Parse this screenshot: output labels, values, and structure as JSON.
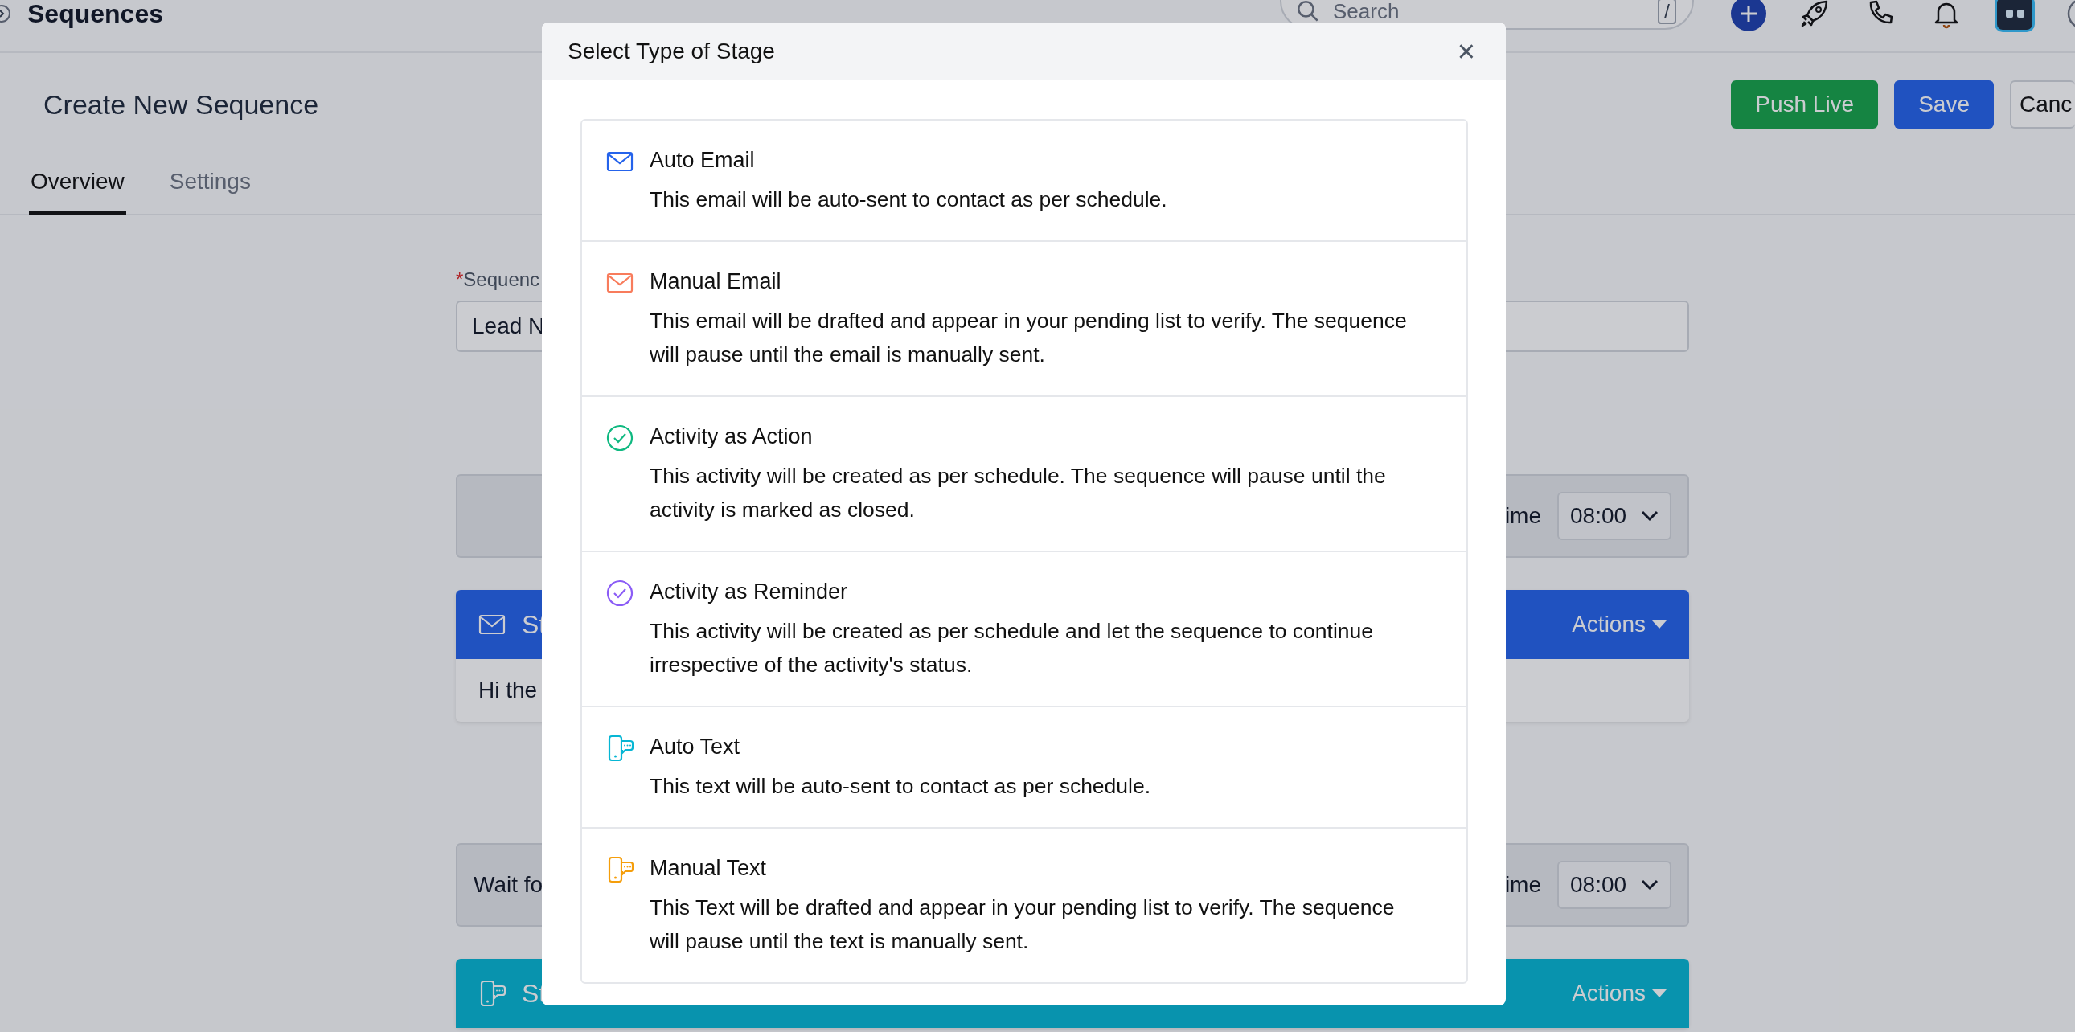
{
  "top_bar": {
    "title": "Sequences",
    "search": {
      "placeholder": "Search",
      "shortcut": "/"
    }
  },
  "page": {
    "title": "Create New Sequence",
    "buttons": [
      {
        "label": "Push Live",
        "kind": "success"
      },
      {
        "label": "Save",
        "kind": "primary"
      },
      {
        "label": "Canc",
        "kind": "default"
      }
    ],
    "tabs": [
      {
        "label": "Overview",
        "selected": true
      },
      {
        "label": "Settings",
        "selected": false
      }
    ],
    "field": {
      "required_mark": "*",
      "label": "Sequenc",
      "value": "Lead N"
    },
    "steps": [
      {
        "kind": "wait",
        "time_label": "ime",
        "time": "08:00"
      },
      {
        "kind": "email_stage",
        "title": "St",
        "actions": "Actions",
        "body": "Hi the"
      },
      {
        "kind": "wait",
        "label": "Wait fo",
        "time_label": "ime",
        "time": "08:00"
      },
      {
        "kind": "text_stage",
        "title": "St",
        "actions": "Actions"
      }
    ]
  },
  "modal": {
    "title": "Select Type of Stage",
    "close": "×",
    "options": [
      {
        "kind": "email",
        "color": "#2563eb",
        "title": "Auto Email",
        "description": "This email will be auto-sent to contact as per schedule."
      },
      {
        "kind": "email",
        "color": "#f87c5c",
        "title": "Manual Email",
        "description": "This email will be drafted and appear in your pending list to verify. The sequence will pause until the email is manually sent."
      },
      {
        "kind": "check",
        "color": "#10b981",
        "title": "Activity as Action",
        "description": "This activity will be created as per schedule. The sequence will pause until the activity is marked as closed."
      },
      {
        "kind": "check",
        "color": "#8b5cf6",
        "title": "Activity as Reminder",
        "description": "This activity will be created as per schedule and let the sequence to continue irrespective of the activity's status."
      },
      {
        "kind": "phone",
        "color": "#06b6d4",
        "title": "Auto Text",
        "description": "This text will be auto-sent to contact as per schedule."
      },
      {
        "kind": "phone",
        "color": "#f59e0b",
        "title": "Manual Text",
        "description": "This Text will be drafted and appear in your pending list to verify. The sequence will pause until the text is manually sent."
      }
    ]
  }
}
